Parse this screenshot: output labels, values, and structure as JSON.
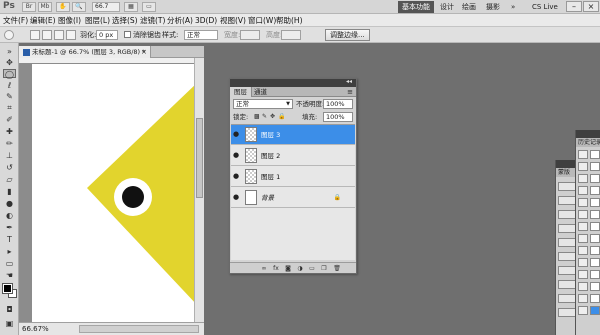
{
  "appbar": {
    "logo": "Ps",
    "zoom": "66.7",
    "workspaces": [
      "基本功能",
      "设计",
      "绘画",
      "摄影"
    ],
    "more": "»",
    "cslive": "CS Live",
    "window_buttons": [
      "–",
      "□",
      "×"
    ]
  },
  "menu": {
    "items": [
      "文件(F)",
      "编辑(E)",
      "图像(I)",
      "图层(L)",
      "选择(S)",
      "滤镜(T)",
      "分析(A)",
      "3D(D)",
      "视图(V)",
      "窗口(W)",
      "帮助(H)"
    ]
  },
  "options": {
    "feather_label": "羽化:",
    "feather_value": "0 px",
    "antialias_label": "消除锯齿",
    "style_label": "样式:",
    "style_value": "正常",
    "width_label": "宽度:",
    "height_label": "高度:",
    "refine_edge_button": "调整边缘..."
  },
  "document": {
    "tab_title": "未标题-1 @ 66.7% (图层 3, RGB/8) *",
    "tab_close": "×",
    "zoom_readout": "66.67%"
  },
  "colors": {
    "fish_yellow": "#e2d42d",
    "eye_black": "#111111",
    "eye_white": "#ffffff",
    "selection_blue": "#3c8ee8"
  },
  "layers_panel": {
    "tabs": [
      "图层",
      "通道"
    ],
    "menu_icon": "≡",
    "blend_mode": "正常",
    "opacity_label": "不透明度:",
    "opacity_value": "100%",
    "lock_label": "锁定:",
    "fill_label": "填充:",
    "fill_value": "100%",
    "layers": [
      {
        "name": "图层 3",
        "selected": true,
        "visible": true
      },
      {
        "name": "图层 2",
        "selected": false,
        "visible": true
      },
      {
        "name": "图层 1",
        "selected": false,
        "visible": true
      },
      {
        "name": "背景",
        "selected": false,
        "visible": true,
        "locked": true
      }
    ]
  },
  "right_panels": {
    "panel_a_tab": "蒙版",
    "panel_b_tab": "历史记录"
  }
}
